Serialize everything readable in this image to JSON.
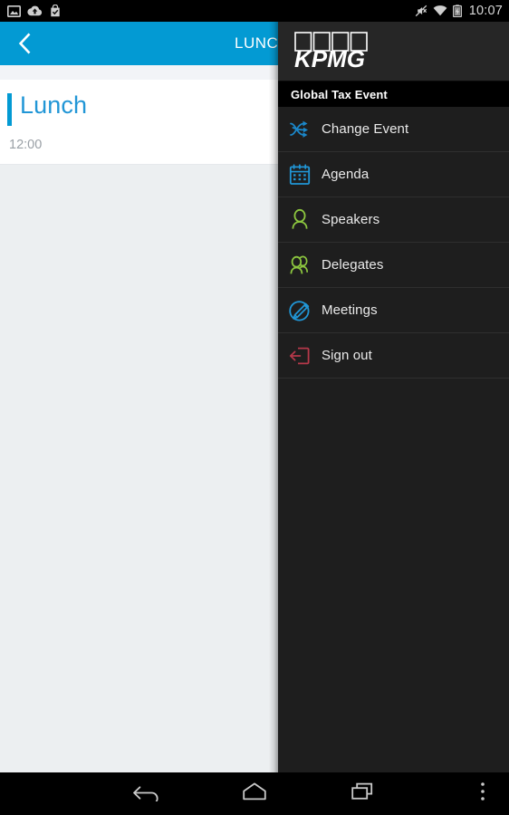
{
  "statusbar": {
    "time": "10:07",
    "left_icons": [
      {
        "name": "gallery-image-icon"
      },
      {
        "name": "cloud-upload-icon"
      },
      {
        "name": "play-store-bag-check-icon"
      }
    ],
    "right_icons": [
      {
        "name": "mute-ringer-off-icon"
      },
      {
        "name": "wifi-icon"
      },
      {
        "name": "battery-charging-icon"
      }
    ]
  },
  "appbar": {
    "title": "LUNCH",
    "back_icon": "back-chevron-icon",
    "accent_color": "#039ad3"
  },
  "detail": {
    "title": "Lunch",
    "time": "12:00",
    "title_color": "#2196d6",
    "time_color": "#9aa0a6"
  },
  "drawer": {
    "brand": "KPMG",
    "event_name": "Global Tax Event",
    "items": [
      {
        "label": "Change Event",
        "icon": "shuffle-arrows-icon",
        "color": "#1b87c9"
      },
      {
        "label": "Agenda",
        "icon": "calendar-icon",
        "color": "#2196d6"
      },
      {
        "label": "Speakers",
        "icon": "person-icon",
        "color": "#8cc63f"
      },
      {
        "label": "Delegates",
        "icon": "people-group-icon",
        "color": "#8cc63f"
      },
      {
        "label": "Meetings",
        "icon": "pen-circle-icon",
        "color": "#2196d6"
      },
      {
        "label": "Sign out",
        "icon": "sign-out-arrow-icon",
        "color": "#b5384a"
      }
    ]
  },
  "navbar": {
    "buttons": [
      {
        "name": "nav-back-button",
        "icon": "back-arrow-icon"
      },
      {
        "name": "nav-home-button",
        "icon": "home-pentagon-icon"
      },
      {
        "name": "nav-recents-button",
        "icon": "recents-squares-icon"
      },
      {
        "name": "nav-overflow-button",
        "icon": "overflow-dots-icon"
      }
    ]
  }
}
